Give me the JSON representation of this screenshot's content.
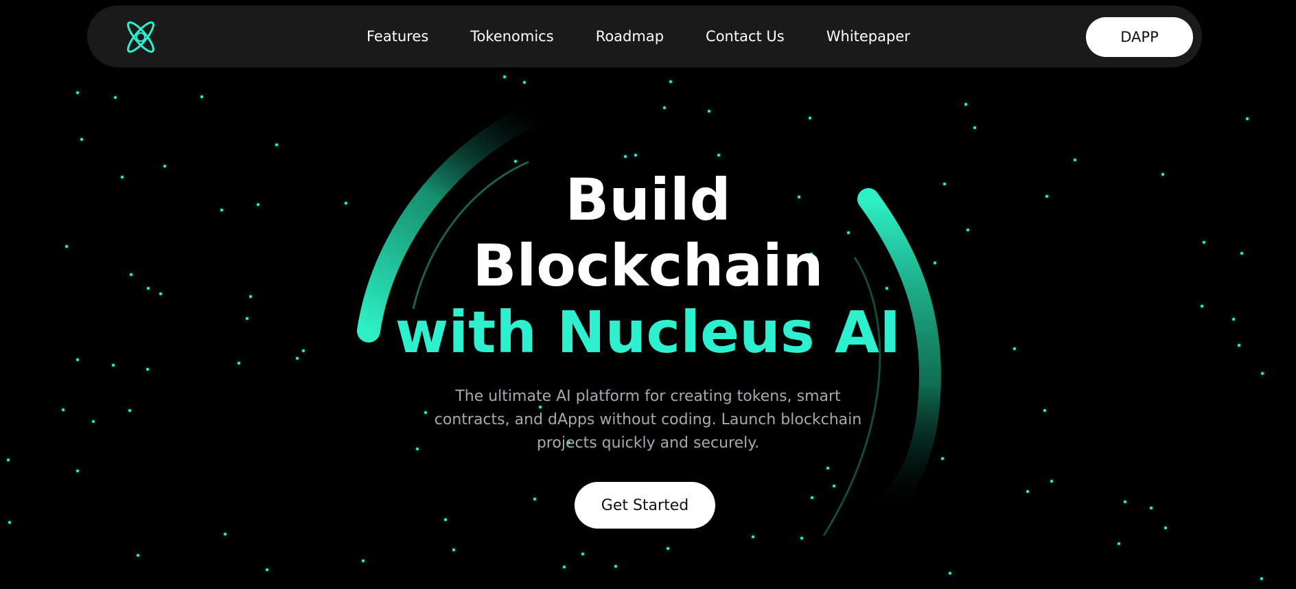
{
  "nav": {
    "links": [
      "Features",
      "Tokenomics",
      "Roadmap",
      "Contact Us",
      "Whitepaper"
    ],
    "cta_label": "DAPP",
    "logo_icon": "atom-logo-icon"
  },
  "hero": {
    "title_line1": "Build",
    "title_line2": "Blockchain",
    "title_line3": "with Nucleus AI",
    "subtitle": "The ultimate AI platform for creating tokens, smart contracts, and dApps without coding. Launch blockchain projects quickly and securely.",
    "cta_label": "Get Started"
  },
  "colors": {
    "background": "#000000",
    "nav_background": "#1a1a1a",
    "accent": "#2df0cf",
    "subtitle_text": "#a6aab0"
  }
}
